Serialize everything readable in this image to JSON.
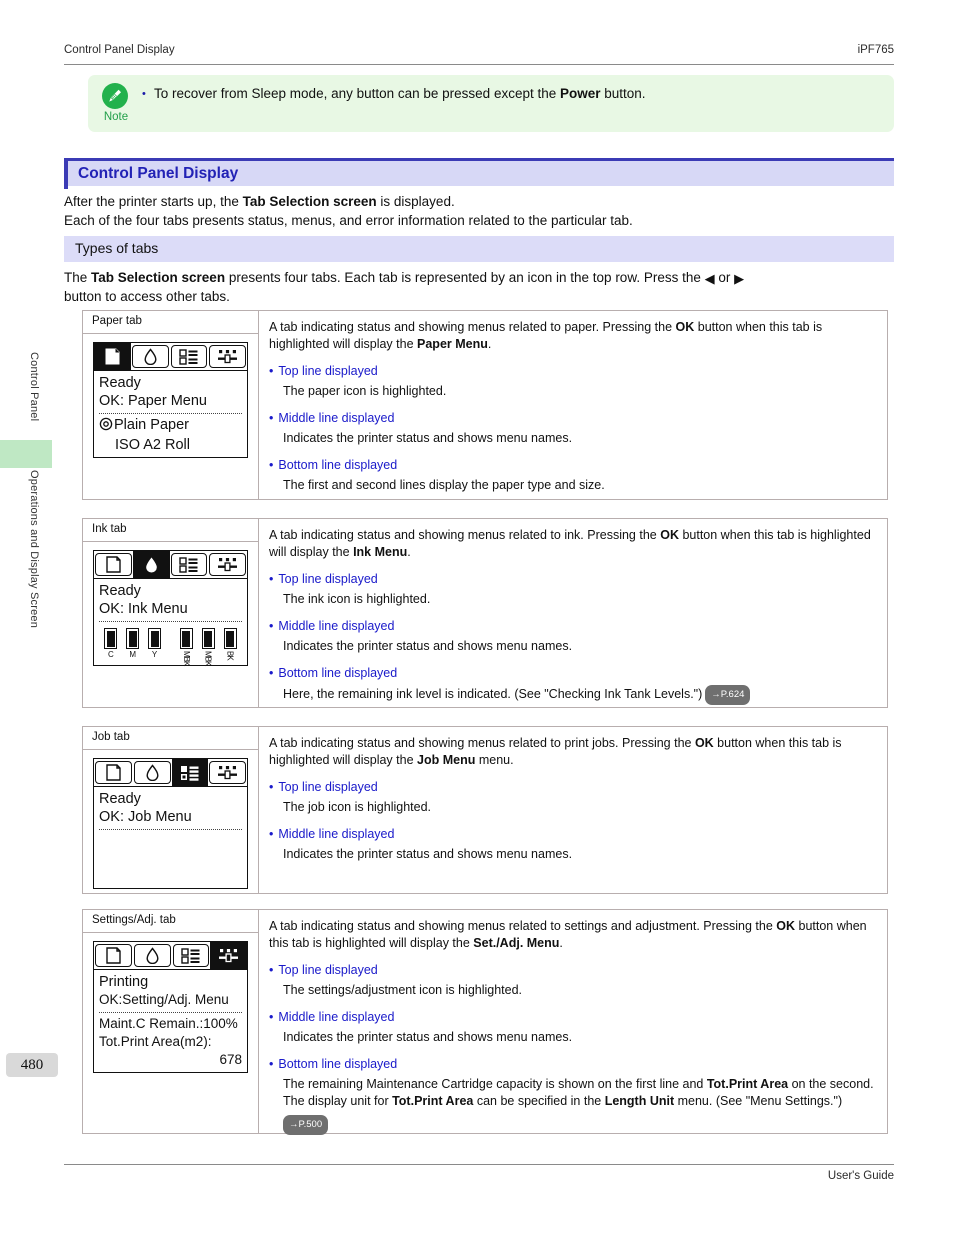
{
  "header": {
    "left": "Control Panel Display",
    "right": "iPF765"
  },
  "footer": {
    "right": "User's Guide"
  },
  "sidebar": {
    "tab_1": "Control Panel",
    "tab_2": "Operations and Display Screen",
    "page_number": "480",
    "highlight_color": "#bfe8c4"
  },
  "note": {
    "label": "Note",
    "bullet": "•",
    "text_1": "To recover from Sleep mode, any button can be pressed except the ",
    "text_bold": "Power",
    "text_2": " button.",
    "bg_color": "#e8f8e4",
    "icon_color": "#22b14c"
  },
  "heading": {
    "title": "Control Panel Display",
    "accent_color": "#3b3bb5",
    "bar_color": "#d7d8f6"
  },
  "intro": {
    "line1_a": "After the printer starts up, the ",
    "line1_b": "Tab Selection screen",
    "line1_c": " is displayed.",
    "line2": "Each of the four tabs presents status, menus, and error information related to the particular tab."
  },
  "subheading": {
    "title": "Types of tabs",
    "bar_color": "#dcdcf8"
  },
  "tabs_intro": {
    "line1_a": "The ",
    "line1_b": "Tab Selection screen",
    "line1_c": " presents four tabs. Each tab is represented by an icon in the top row. Press the ",
    "left_arrow": "◀",
    "or": " or ",
    "right_arrow": "▶",
    "line2": "button to access other tabs."
  },
  "rows": [
    {
      "caption": "Paper tab",
      "selected_tab": 0,
      "lcd": {
        "line1": "Ready",
        "line2": "OK: Paper Menu",
        "bottom1": "Plain Paper",
        "bottom2": "ISO A2 Roll",
        "has_roll_icon": true
      },
      "desc_a": "A tab indicating status and showing menus related to paper. Pressing the ",
      "desc_b": "OK",
      "desc_c": " button when this tab is highlighted will display the ",
      "desc_d": "Paper Menu",
      "desc_e": ".",
      "items": [
        {
          "title": "Top line displayed",
          "sub": "The paper icon is highlighted."
        },
        {
          "title": "Middle line displayed",
          "sub": "Indicates the printer status and shows menu names."
        },
        {
          "title": "Bottom line displayed",
          "sub": "The first and second lines display the paper type and size."
        }
      ]
    },
    {
      "caption": "Ink tab",
      "selected_tab": 1,
      "lcd": {
        "line1": "Ready",
        "line2": "OK: Ink Menu",
        "ink_labels": [
          "C",
          "M",
          "Y",
          "MBK",
          "MBK",
          "BK"
        ]
      },
      "desc_a": "A tab indicating status and showing menus related to ink. Pressing the ",
      "desc_b": "OK",
      "desc_c": " button when this tab is highlighted will display the ",
      "desc_d": "Ink Menu",
      "desc_e": ".",
      "items": [
        {
          "title": "Top line displayed",
          "sub": "The ink icon is highlighted."
        },
        {
          "title": "Middle line displayed",
          "sub": "Indicates the printer status and shows menu names."
        },
        {
          "title": "Bottom line displayed",
          "sub": "Here, the remaining ink level is indicated.  (See \"Checking Ink Tank Levels.\")",
          "badge": "→P.624"
        }
      ]
    },
    {
      "caption": "Job tab",
      "selected_tab": 2,
      "lcd": {
        "line1": "Ready",
        "line2": "OK: Job Menu"
      },
      "desc_a": "A tab indicating status and showing menus related to print jobs. Pressing the ",
      "desc_b": "OK",
      "desc_c": " button when this tab is highlighted will display the ",
      "desc_d": "Job Menu",
      "desc_e": " menu.",
      "items": [
        {
          "title": "Top line displayed",
          "sub": "The job icon is highlighted."
        },
        {
          "title": "Middle line displayed",
          "sub": "Indicates the printer status and shows menu names."
        }
      ]
    },
    {
      "caption": "Settings/Adj. tab",
      "selected_tab": 3,
      "lcd": {
        "line1": "Printing",
        "line2": "OK:Setting/Adj. Menu",
        "bottom1": "Maint.C Remain.:100%",
        "bottom2": "Tot.Print Area(m2):",
        "bottom3": "678"
      },
      "desc_a": "A tab indicating status and showing menus related to settings and adjustment. Pressing the ",
      "desc_b": "OK",
      "desc_c": " button when this tab is highlighted will display the ",
      "desc_d": "Set./Adj. Menu",
      "desc_e": ".",
      "items": [
        {
          "title": "Top line displayed",
          "sub": "The settings/adjustment icon is highlighted."
        },
        {
          "title": "Middle line displayed",
          "sub": "Indicates the printer status and shows menu names."
        },
        {
          "title": "Bottom line displayed",
          "sub": "",
          "badge": "→P.500"
        }
      ],
      "bottom_rich": {
        "a": "The remaining Maintenance Cartridge capacity is shown on the first line and ",
        "b": "Tot.Print Area",
        "c": " on the second.",
        "d": "The display unit for ",
        "e": "Tot.Print Area",
        "f": " can be specified in the ",
        "g": "Length Unit",
        "h": " menu.  (See \"Menu Settings.\")"
      }
    }
  ],
  "icons": {
    "paper": "paper-sheet-icon",
    "ink": "ink-drop-icon",
    "job": "job-list-icon",
    "settings": "settings-slider-icon"
  }
}
